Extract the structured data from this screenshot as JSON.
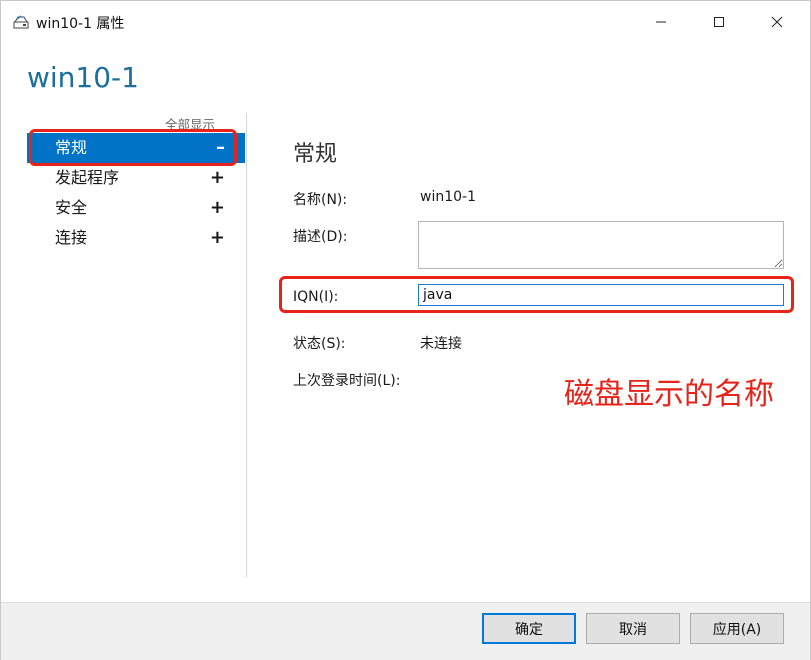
{
  "window": {
    "title": "win10-1 属性",
    "heading": "win10-1"
  },
  "nav": {
    "show_all": "全部显示",
    "items": [
      {
        "label": "常规",
        "sign": "–"
      },
      {
        "label": "发起程序",
        "sign": "+"
      },
      {
        "label": "安全",
        "sign": "+"
      },
      {
        "label": "连接",
        "sign": "+"
      }
    ]
  },
  "content": {
    "section_title": "常规",
    "name_label": "名称(N):",
    "name_value": "win10-1",
    "desc_label": "描述(D):",
    "iqn_label": "IQN(I):",
    "iqn_value": "java",
    "status_label": "状态(S):",
    "status_value": "未连接",
    "last_login_label": "上次登录时间(L):"
  },
  "annotation": {
    "text": "磁盘显示的名称",
    "color": "#e8231a"
  },
  "buttons": {
    "ok": "确定",
    "cancel": "取消",
    "apply": "应用(A)"
  },
  "colors": {
    "accent": "#0073c6",
    "heading": "#1c6e9c",
    "highlight": "#e8231a"
  }
}
